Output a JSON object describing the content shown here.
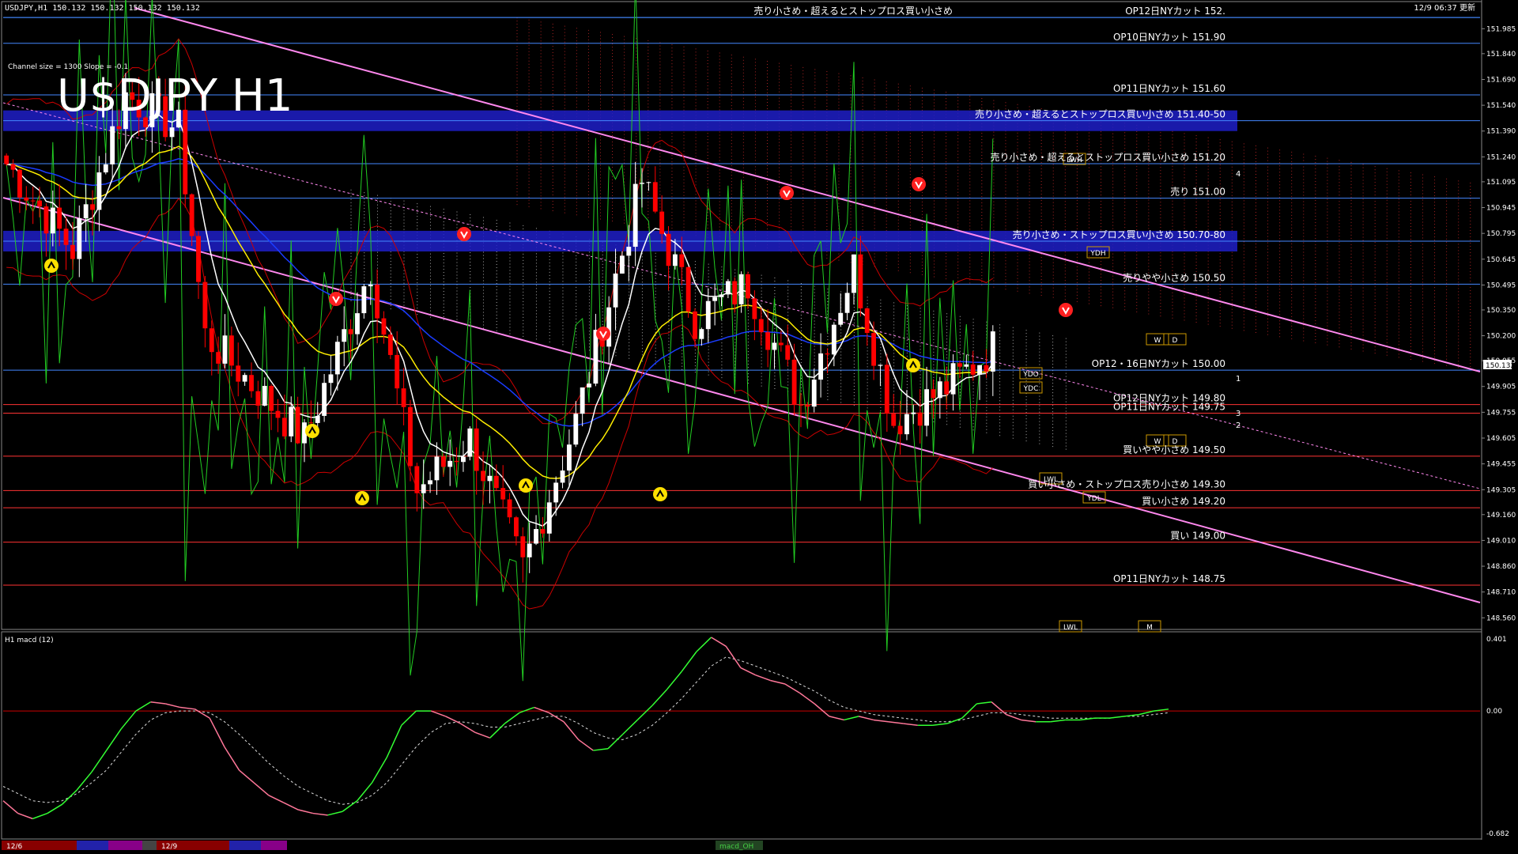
{
  "window": {
    "info_bar": "USDJPY,H1  150.132 150.132 150.132 150.132",
    "symbol_title": "U$DJPY H1",
    "channel_info": "Channel size = 1300 Slope = -0.1",
    "update_time": "12/9 06:37 更新"
  },
  "colors": {
    "background": "#000000",
    "bull_candle": "#ffffff",
    "bear_candle": "#ff0000",
    "ema_white": "#ffffff",
    "ema_yellow": "#ffee00",
    "ma_blue": "#1a3cff",
    "bollinger": "#cc0000",
    "rsi_green": "#22cc22",
    "channel_pink": "#ff88ee",
    "zone_blue": "#1e1ec8",
    "macd_main": "#33ff33",
    "macd_neg": "#ff7799"
  },
  "chart_data": [
    {
      "type": "candlestick",
      "name": "main",
      "y_axis_ticks": [
        "151.985",
        "151.840",
        "151.690",
        "151.540",
        "151.390",
        "151.240",
        "151.095",
        "150.945",
        "150.795",
        "150.645",
        "150.495",
        "150.350",
        "150.200",
        "150.055",
        "149.905",
        "149.755",
        "149.605",
        "149.455",
        "149.305",
        "149.160",
        "149.010",
        "148.860",
        "148.710",
        "148.560"
      ],
      "current_price": "150.132",
      "ylim": [
        148.52,
        152.06
      ],
      "levels": [
        {
          "text": "売り小さめ・超えるとストップロス買い小さめ",
          "price": 152.05,
          "color": "#4488ff",
          "label_x": 1205,
          "zone": false
        },
        {
          "text": "OP12日NYカット 152.",
          "price": 152.05,
          "color": "#4488ff",
          "label_x": 1550,
          "zone": false
        },
        {
          "text": "OP10日NYカット 151.90",
          "price": 151.9,
          "color": "#4488ff",
          "label_x": 1550,
          "zone": false
        },
        {
          "text": "OP11日NYカット 151.60",
          "price": 151.6,
          "color": "#4488ff",
          "label_x": 1550,
          "zone": false
        },
        {
          "text": "売り小さめ・超えるとストップロス買い小さめ 151.40-50",
          "price": 151.45,
          "color": "#4488ff",
          "label_x": 1550,
          "zone": true
        },
        {
          "text": "売り小さめ・超えるとストップロス買い小さめ 151.20",
          "price": 151.2,
          "color": "#4488ff",
          "label_x": 1550,
          "zone": false
        },
        {
          "text": "売り 151.00",
          "price": 151.0,
          "color": "#4488ff",
          "label_x": 1550,
          "zone": false
        },
        {
          "text": "売り小さめ・ストップロス買い小さめ 150.70-80",
          "price": 150.75,
          "color": "#4488ff",
          "label_x": 1550,
          "zone": true
        },
        {
          "text": "売りやや小さめ 150.50",
          "price": 150.5,
          "color": "#4488ff",
          "label_x": 1550,
          "zone": false
        },
        {
          "text": "OP12・16日NYカット 150.00",
          "price": 150.0,
          "color": "#4488ff",
          "label_x": 1550,
          "zone": false
        },
        {
          "text": "OP12日NYカット 149.80",
          "price": 149.8,
          "color": "#ff3333",
          "label_x": 1550,
          "zone": false
        },
        {
          "text": "OP11日NYカット 149.75",
          "price": 149.75,
          "color": "#ff3333",
          "label_x": 1550,
          "zone": false
        },
        {
          "text": "買いやや小さめ 149.50",
          "price": 149.5,
          "color": "#ff3333",
          "label_x": 1550,
          "zone": false
        },
        {
          "text": "買い小さめ・ストップロス売り小さめ 149.30",
          "price": 149.3,
          "color": "#ff3333",
          "label_x": 1550,
          "zone": false
        },
        {
          "text": "買い小さめ 149.20",
          "price": 149.2,
          "color": "#ff3333",
          "label_x": 1550,
          "zone": false
        },
        {
          "text": "買い 149.00",
          "price": 149.0,
          "color": "#ff3333",
          "label_x": 1550,
          "zone": false
        },
        {
          "text": "OP11日NYカット 148.75",
          "price": 148.75,
          "color": "#ff3333",
          "label_x": 1550,
          "zone": false
        }
      ],
      "box_markers": [
        "LWH",
        "YDH",
        "W",
        "D",
        "YDO",
        "YDC",
        "W",
        "D",
        "LWL",
        "YDL",
        "LWL",
        "M"
      ],
      "wave_labels": [
        "4",
        "1",
        "3",
        "2"
      ],
      "candles": {
        "count": 150,
        "start": 151.2,
        "end": 150.13
      }
    },
    {
      "type": "line",
      "name": "macd",
      "title": "H1  macd (12)",
      "y_axis_ticks": [
        "0.401",
        "0.00",
        "-0.682"
      ],
      "ylim": [
        -0.682,
        0.401
      ],
      "zero_line": 0.0,
      "series": [
        {
          "values": [
            -0.5,
            -0.57,
            -0.6,
            -0.57,
            -0.52,
            -0.44,
            -0.34,
            -0.22,
            -0.1,
            0.0,
            0.05,
            0.04,
            0.02,
            0.01,
            -0.04,
            -0.2,
            -0.33,
            -0.4,
            -0.47,
            -0.51,
            -0.55,
            -0.57,
            -0.58,
            -0.56,
            -0.5,
            -0.4,
            -0.26,
            -0.08,
            0.0,
            0.0,
            -0.03,
            -0.07,
            -0.12,
            -0.15,
            -0.07,
            -0.01,
            0.02,
            -0.01,
            -0.06,
            -0.16,
            -0.22,
            -0.21,
            -0.13,
            -0.05,
            0.03,
            0.12,
            0.22,
            0.33,
            0.41,
            0.36,
            0.24,
            0.2,
            0.17,
            0.15,
            0.1,
            0.04,
            -0.03,
            -0.05,
            -0.03,
            -0.05,
            -0.06,
            -0.07,
            -0.08,
            -0.08,
            -0.07,
            -0.04,
            0.04,
            0.05,
            -0.02,
            -0.05,
            -0.06,
            -0.06,
            -0.05,
            -0.05,
            -0.04,
            -0.04,
            -0.03,
            -0.02,
            0.0,
            0.01
          ]
        },
        {
          "values": [
            -0.42,
            -0.46,
            -0.5,
            -0.51,
            -0.5,
            -0.46,
            -0.4,
            -0.33,
            -0.23,
            -0.13,
            -0.05,
            -0.01,
            0.0,
            0.0,
            -0.01,
            -0.06,
            -0.13,
            -0.21,
            -0.29,
            -0.36,
            -0.42,
            -0.46,
            -0.5,
            -0.52,
            -0.51,
            -0.47,
            -0.4,
            -0.3,
            -0.2,
            -0.12,
            -0.07,
            -0.06,
            -0.07,
            -0.09,
            -0.09,
            -0.07,
            -0.05,
            -0.03,
            -0.03,
            -0.07,
            -0.12,
            -0.15,
            -0.16,
            -0.13,
            -0.08,
            -0.01,
            0.07,
            0.16,
            0.25,
            0.3,
            0.28,
            0.25,
            0.22,
            0.19,
            0.15,
            0.11,
            0.06,
            0.02,
            0.0,
            -0.02,
            -0.03,
            -0.04,
            -0.05,
            -0.06,
            -0.06,
            -0.05,
            -0.03,
            -0.01,
            -0.01,
            -0.02,
            -0.03,
            -0.04,
            -0.04,
            -0.04,
            -0.04,
            -0.04,
            -0.03,
            -0.03,
            -0.02,
            -0.01
          ]
        }
      ]
    }
  ],
  "bottom_bar": {
    "date1": "12/6",
    "date2": "12/9",
    "indicator": "macd_OH"
  }
}
